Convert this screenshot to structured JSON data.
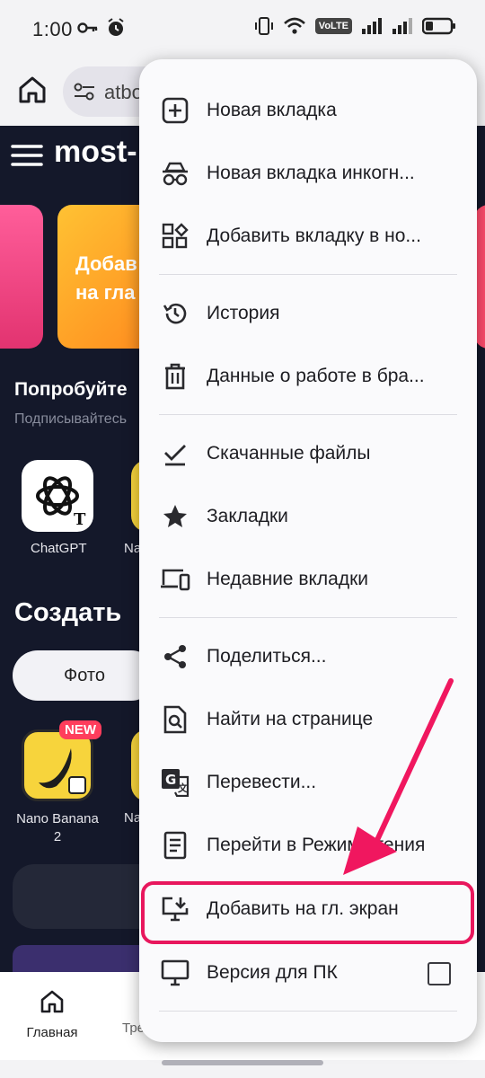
{
  "status_bar": {
    "time": "1:00",
    "volte": "VoLTE"
  },
  "toolbar": {
    "url_fragment": "atbo"
  },
  "page": {
    "brand": "most-",
    "banner_text": "Добав на гла",
    "section_title": "Попробуйте",
    "section_subtitle": "Подписывайтесь",
    "apps": [
      {
        "label": "ChatGPT"
      },
      {
        "label": "Na"
      }
    ],
    "create_title": "Создать",
    "chip_label": "Фото",
    "new_badge": "NEW",
    "banana_label": "Nano Banana 2",
    "banana_label2": "Na",
    "nav": {
      "home_label": "Главная",
      "second_label": "Тре"
    }
  },
  "menu": {
    "items": [
      {
        "label": "Новая вкладка",
        "icon": "add-tab-icon"
      },
      {
        "label": "Новая вкладка инкогн...",
        "icon": "incognito-icon"
      },
      {
        "label": "Добавить вкладку в но...",
        "icon": "add-to-group-icon"
      },
      {
        "label": "История",
        "icon": "history-icon"
      },
      {
        "label": "Данные  о работе в бра...",
        "icon": "trash-icon"
      },
      {
        "label": "Скачанные файлы",
        "icon": "downloads-icon"
      },
      {
        "label": "Закладки",
        "icon": "star-icon"
      },
      {
        "label": "Недавние вкладки",
        "icon": "devices-icon"
      },
      {
        "label": "Поделиться...",
        "icon": "share-icon"
      },
      {
        "label": "Найти на странице",
        "icon": "find-in-page-icon"
      },
      {
        "label": "Перевести...",
        "icon": "translate-icon"
      },
      {
        "label": "Перейти в Режим чтения",
        "icon": "reader-mode-icon"
      },
      {
        "label": "Добавить на гл. экран",
        "icon": "add-to-home-icon"
      },
      {
        "label": "Версия для ПК",
        "icon": "desktop-icon"
      }
    ]
  },
  "colors": {
    "accent_highlight": "#e8175d",
    "page_bg": "#14182a",
    "menu_bg": "#fafafc"
  }
}
